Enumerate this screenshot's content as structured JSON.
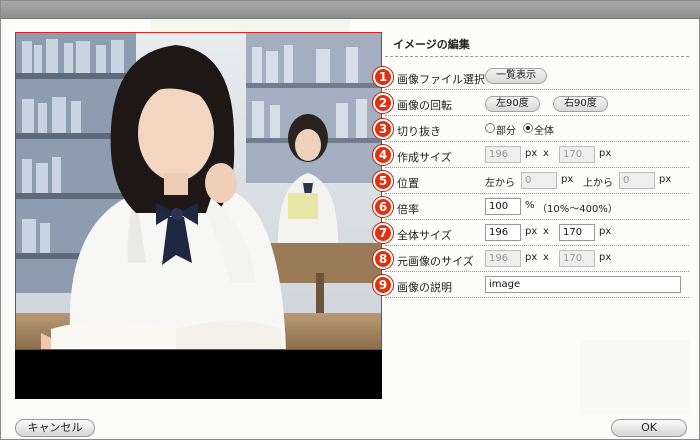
{
  "panel": {
    "title": "イメージの編集"
  },
  "rows": [
    {
      "num": "1",
      "label": "画像ファイル選択",
      "button": "一覧表示"
    },
    {
      "num": "2",
      "label": "画像の回転",
      "rotate_left": "左90度",
      "rotate_right": "右90度"
    },
    {
      "num": "3",
      "label": "切り抜き",
      "option_part": "部分",
      "option_all": "全体",
      "selected": "全体"
    },
    {
      "num": "4",
      "label": "作成サイズ",
      "width": "196",
      "height": "170",
      "unit": "px",
      "times": "x"
    },
    {
      "num": "5",
      "label": "位置",
      "left_label": "左から",
      "left_value": "0",
      "top_label": "上から",
      "top_value": "0",
      "unit": "px"
    },
    {
      "num": "6",
      "label": "倍率",
      "value": "100",
      "unit": "%",
      "note": "（10%〜400%）"
    },
    {
      "num": "7",
      "label": "全体サイズ",
      "width": "196",
      "height": "170",
      "unit": "px",
      "times": "x"
    },
    {
      "num": "8",
      "label": "元画像のサイズ",
      "width": "196",
      "height": "170",
      "unit": "px",
      "times": "x"
    },
    {
      "num": "9",
      "label": "画像の説明",
      "value": "image"
    }
  ],
  "footer": {
    "cancel": "キャンセル",
    "ok": "OK"
  }
}
